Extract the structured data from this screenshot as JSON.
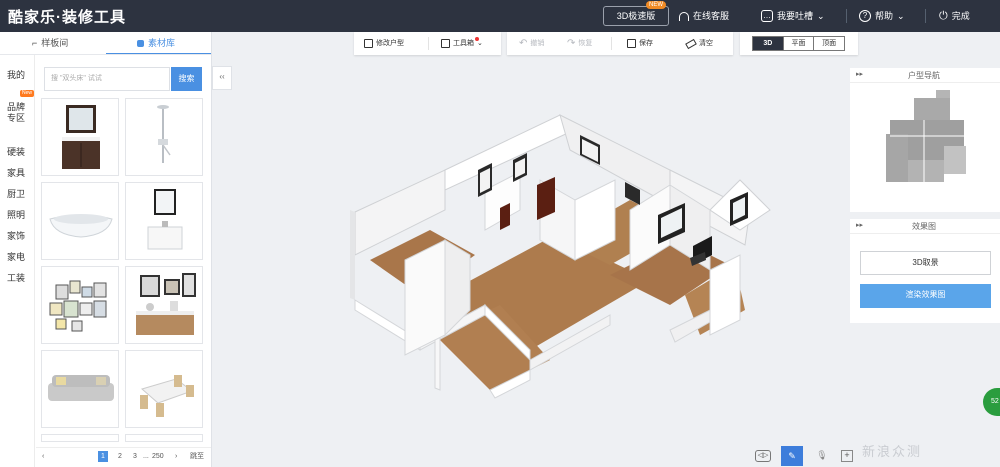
{
  "header": {
    "logo": "酷家乐·装修工具",
    "btn_3d_fast": "3D极速版",
    "new_badge": "NEW",
    "online_service": "在线客服",
    "feedback": "我要吐槽",
    "help": "帮助",
    "finish": "完成"
  },
  "left": {
    "tab_template": "样板间",
    "tab_materials": "素材库",
    "categories": [
      "我的",
      "品牌专区",
      "硬装",
      "家具",
      "厨卫",
      "照明",
      "家饰",
      "家电",
      "工装"
    ],
    "brand_badge": "New",
    "search_placeholder": "搜 \"双头床\" 试试",
    "search_button": "搜索",
    "items": [
      {
        "name": "bathroom-vanity-mirror"
      },
      {
        "name": "shower-set"
      },
      {
        "name": "bathtub"
      },
      {
        "name": "wash-basin-cabinet"
      },
      {
        "name": "picture-frames-wall"
      },
      {
        "name": "decor-frames-sideboard"
      },
      {
        "name": "sofa"
      },
      {
        "name": "dining-table-set"
      }
    ],
    "pager": {
      "prev": "‹",
      "p1": "1",
      "p2": "2",
      "p3": "3",
      "ellipsis": "...",
      "last": "250",
      "next": "›",
      "jump": "跳至"
    }
  },
  "toolbar": {
    "edit_floorplan": "修改户型",
    "tools": "工具箱",
    "undo": "撤销",
    "redo": "恢复",
    "save": "保存",
    "clear": "清空",
    "views": [
      "3D",
      "平面",
      "顶面"
    ],
    "active_view": "3D"
  },
  "right": {
    "floorplan_nav_title": "户型导航",
    "render_title": "效果图",
    "btn_3d_view": "3D取景",
    "btn_render": "渲染效果图",
    "render_button_color": "#5aa5ea"
  },
  "floating_badge": "52",
  "watermark": "新浪众测",
  "colors": {
    "topbar": "#2d3340",
    "accent": "#4a90e2",
    "floor_wood": "#a9764a",
    "wall": "#ffffff"
  }
}
